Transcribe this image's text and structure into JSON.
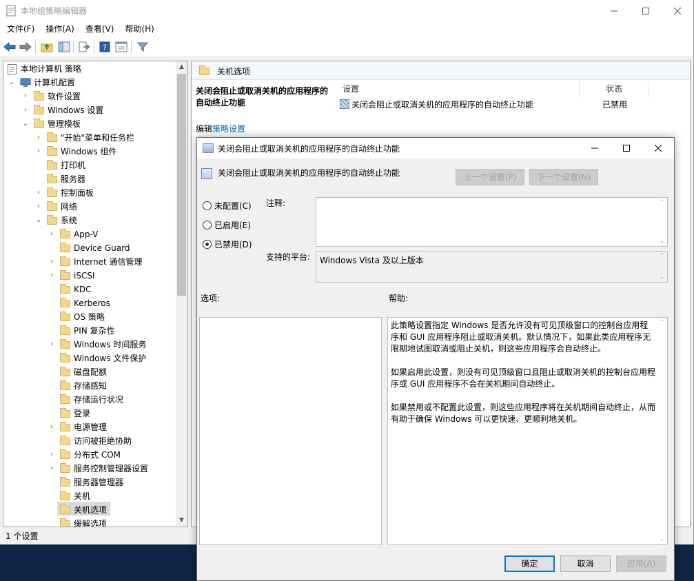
{
  "window": {
    "title": "本地组策略编辑器",
    "minimize": "—",
    "maximize": "☐",
    "close": "✕"
  },
  "menu": [
    {
      "label": "文件(F)"
    },
    {
      "label": "操作(A)"
    },
    {
      "label": "查看(V)"
    },
    {
      "label": "帮助(H)"
    }
  ],
  "tree": {
    "root": "本地计算机 策略",
    "computer_config": "计算机配置",
    "software": "软件设置",
    "windows_settings": "Windows 设置",
    "admin_templates": "管理模板",
    "start_menu": "\"开始\"菜单和任务栏",
    "windows_components": "Windows 组件",
    "printers": "打印机",
    "server": "服务器",
    "control_panel": "控制面板",
    "network": "网络",
    "system": "系统",
    "items": [
      {
        "label": "App-V",
        "expandable": true
      },
      {
        "label": "Device Guard",
        "expandable": false
      },
      {
        "label": "Internet 通信管理",
        "expandable": true
      },
      {
        "label": "iSCSI",
        "expandable": true
      },
      {
        "label": "KDC",
        "expandable": false
      },
      {
        "label": "Kerberos",
        "expandable": false
      },
      {
        "label": "OS 策略",
        "expandable": false
      },
      {
        "label": "PIN 复杂性",
        "expandable": false
      },
      {
        "label": "Windows 时间服务",
        "expandable": true
      },
      {
        "label": "Windows 文件保护",
        "expandable": false
      },
      {
        "label": "磁盘配额",
        "expandable": false
      },
      {
        "label": "存储感知",
        "expandable": false
      },
      {
        "label": "存储运行状况",
        "expandable": false
      },
      {
        "label": "登录",
        "expandable": false
      },
      {
        "label": "电源管理",
        "expandable": true
      },
      {
        "label": "访问被拒绝协助",
        "expandable": false
      },
      {
        "label": "分布式 COM",
        "expandable": true
      },
      {
        "label": "服务控制管理器设置",
        "expandable": true
      },
      {
        "label": "服务器管理器",
        "expandable": false
      },
      {
        "label": "关机",
        "expandable": false
      },
      {
        "label": "关机选项",
        "expandable": false
      },
      {
        "label": "缓解选项",
        "expandable": false
      }
    ]
  },
  "right": {
    "header": "关机选项",
    "desc_title": "关闭会阻止或取消关机的应用程序的自动终止功能",
    "edit_prefix": "编辑",
    "edit_link": "策略设置",
    "col_setting": "设置",
    "col_status": "状态",
    "row_setting": "关闭会阻止或取消关机的应用程序的自动终止功能",
    "row_status": "已禁用"
  },
  "statusbar": "1 个设置",
  "dialog": {
    "title": "关闭会阻止或取消关机的应用程序的自动终止功能",
    "subtitle": "关闭会阻止或取消关机的应用程序的自动终止功能",
    "prev": "上一个设置(P)",
    "next": "下一个设置(N)",
    "not_configured": "未配置(C)",
    "enabled": "已启用(E)",
    "disabled": "已禁用(D)",
    "selected_state": "disabled",
    "comment_label": "注释:",
    "comment_value": "",
    "platform_label": "支持的平台:",
    "platform_value": "Windows Vista 及以上版本",
    "options_label": "选项:",
    "help_label": "帮助:",
    "help_p1": "此策略设置指定 Windows 是否允许没有可见顶级窗口的控制台应用程序和 GUI 应用程序阻止或取消关机。默认情况下，如果此类应用程序无限期地试图取消或阻止关机，则这些应用程序会自动终止。",
    "help_p2": "如果启用此设置，则没有可见顶级窗口且阻止或取消关机的控制台应用程序或 GUI 应用程序不会在关机期间自动终止。",
    "help_p3": "如果禁用或不配置此设置，则这些应用程序将在关机期间自动终止，从而有助于确保 Windows 可以更快速、更顺利地关机。",
    "ok": "确定",
    "cancel": "取消",
    "apply": "应用(A)"
  }
}
